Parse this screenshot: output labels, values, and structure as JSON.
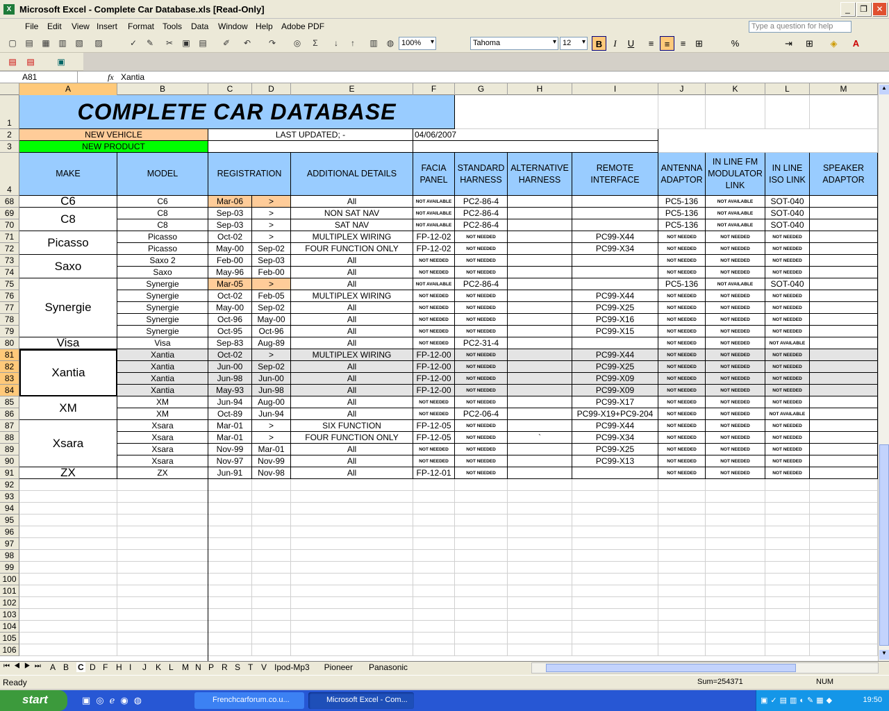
{
  "window": {
    "title": "Microsoft Excel - Complete Car Database.xls  [Read-Only]"
  },
  "menu": [
    "File",
    "Edit",
    "View",
    "Insert",
    "Format",
    "Tools",
    "Data",
    "Window",
    "Help",
    "Adobe PDF"
  ],
  "help_placeholder": "Type a question for help",
  "toolbar": {
    "zoom": "100%",
    "font": "Tahoma",
    "size": "12"
  },
  "formula": {
    "namebox": "A81",
    "fx": "fx",
    "value": "Xantia"
  },
  "columns": [
    "A",
    "B",
    "C",
    "D",
    "E",
    "F",
    "G",
    "H",
    "I",
    "J",
    "K",
    "L",
    "M"
  ],
  "title": "COMPLETE CAR DATABASE",
  "row2": {
    "new_vehicle": "NEW VEHICLE",
    "last_updated": "LAST UPDATED;  -",
    "date": "04/06/2007"
  },
  "row3": {
    "new_product": "NEW PRODUCT"
  },
  "headers": [
    "MAKE",
    "MODEL",
    "REGISTRATION",
    "ADDITIONAL DETAILS",
    "FACIA PANEL",
    "STANDARD HARNESS",
    "ALTERNATIVE HARNESS",
    "REMOTE INTERFACE",
    "ANTENNA ADAPTOR",
    "IN LINE FM MODULATOR LINK",
    "IN LINE ISO LINK",
    "SPEAKER ADAPTOR"
  ],
  "makes": [
    {
      "name": "C6",
      "rows": [
        68
      ]
    },
    {
      "name": "C8",
      "rows": [
        69,
        70
      ]
    },
    {
      "name": "Picasso",
      "rows": [
        71,
        72
      ]
    },
    {
      "name": "Saxo",
      "rows": [
        73,
        74
      ]
    },
    {
      "name": "Synergie",
      "rows": [
        75,
        76,
        77,
        78,
        79
      ]
    },
    {
      "name": "Visa",
      "rows": [
        80
      ]
    },
    {
      "name": "Xantia",
      "rows": [
        81,
        82,
        83,
        84
      ]
    },
    {
      "name": "XM",
      "rows": [
        85,
        86
      ]
    },
    {
      "name": "Xsara",
      "rows": [
        87,
        88,
        89,
        90
      ]
    },
    {
      "name": "ZX",
      "rows": [
        91
      ]
    }
  ],
  "rows": [
    {
      "n": "68",
      "model": "C6",
      "from": "Mar-06",
      "to": ">",
      "details": "All",
      "facia": "NOT AVAILABLE",
      "std": "PC2-86-4",
      "alt": "",
      "remote": "",
      "ant": "PC5-136",
      "fm": "NOT AVAILABLE",
      "iso": "SOT-040",
      "new": true
    },
    {
      "n": "69",
      "model": "C8",
      "from": "Sep-03",
      "to": ">",
      "details": "NON SAT NAV",
      "facia": "NOT AVAILABLE",
      "std": "PC2-86-4",
      "alt": "",
      "remote": "",
      "ant": "PC5-136",
      "fm": "NOT AVAILABLE",
      "iso": "SOT-040"
    },
    {
      "n": "70",
      "model": "C8",
      "from": "Sep-03",
      "to": ">",
      "details": "SAT NAV",
      "facia": "NOT AVAILABLE",
      "std": "PC2-86-4",
      "alt": "",
      "remote": "",
      "ant": "PC5-136",
      "fm": "NOT AVAILABLE",
      "iso": "SOT-040"
    },
    {
      "n": "71",
      "model": "Picasso",
      "from": "Oct-02",
      "to": ">",
      "details": "MULTIPLEX WIRING",
      "facia": "FP-12-02",
      "std": "NOT NEEDED",
      "alt": "",
      "remote": "PC99-X44",
      "ant": "NOT NEEDED",
      "fm": "NOT NEEDED",
      "iso": "NOT NEEDED"
    },
    {
      "n": "72",
      "model": "Picasso",
      "from": "May-00",
      "to": "Sep-02",
      "details": "FOUR FUNCTION ONLY",
      "facia": "FP-12-02",
      "std": "NOT NEEDED",
      "alt": "",
      "remote": "PC99-X34",
      "ant": "NOT NEEDED",
      "fm": "NOT NEEDED",
      "iso": "NOT NEEDED"
    },
    {
      "n": "73",
      "model": "Saxo 2",
      "from": "Feb-00",
      "to": "Sep-03",
      "details": "All",
      "facia": "NOT NEEDED",
      "std": "NOT NEEDED",
      "alt": "",
      "remote": "",
      "ant": "NOT NEEDED",
      "fm": "NOT NEEDED",
      "iso": "NOT NEEDED"
    },
    {
      "n": "74",
      "model": "Saxo",
      "from": "May-96",
      "to": "Feb-00",
      "details": "All",
      "facia": "NOT NEEDED",
      "std": "NOT NEEDED",
      "alt": "",
      "remote": "",
      "ant": "NOT NEEDED",
      "fm": "NOT NEEDED",
      "iso": "NOT NEEDED"
    },
    {
      "n": "75",
      "model": "Synergie",
      "from": "Mar-05",
      "to": ">",
      "details": "All",
      "facia": "NOT AVAILABLE",
      "std": "PC2-86-4",
      "alt": "",
      "remote": "",
      "ant": "PC5-136",
      "fm": "NOT AVAILABLE",
      "iso": "SOT-040",
      "new": true
    },
    {
      "n": "76",
      "model": "Synergie",
      "from": "Oct-02",
      "to": "Feb-05",
      "details": "MULTIPLEX WIRING",
      "facia": "NOT NEEDED",
      "std": "NOT NEEDED",
      "alt": "",
      "remote": "PC99-X44",
      "ant": "NOT NEEDED",
      "fm": "NOT NEEDED",
      "iso": "NOT NEEDED"
    },
    {
      "n": "77",
      "model": "Synergie",
      "from": "May-00",
      "to": "Sep-02",
      "details": "All",
      "facia": "NOT NEEDED",
      "std": "NOT NEEDED",
      "alt": "",
      "remote": "PC99-X25",
      "ant": "NOT NEEDED",
      "fm": "NOT NEEDED",
      "iso": "NOT NEEDED"
    },
    {
      "n": "78",
      "model": "Synergie",
      "from": "Oct-96",
      "to": "May-00",
      "details": "All",
      "facia": "NOT NEEDED",
      "std": "NOT NEEDED",
      "alt": "",
      "remote": "PC99-X16",
      "ant": "NOT NEEDED",
      "fm": "NOT NEEDED",
      "iso": "NOT NEEDED"
    },
    {
      "n": "79",
      "model": "Synergie",
      "from": "Oct-95",
      "to": "Oct-96",
      "details": "All",
      "facia": "NOT NEEDED",
      "std": "NOT NEEDED",
      "alt": "",
      "remote": "PC99-X15",
      "ant": "NOT NEEDED",
      "fm": "NOT NEEDED",
      "iso": "NOT NEEDED"
    },
    {
      "n": "80",
      "model": "Visa",
      "from": "Sep-83",
      "to": "Aug-89",
      "details": "All",
      "facia": "NOT NEEDED",
      "std": "PC2-31-4",
      "alt": "",
      "remote": "",
      "ant": "NOT NEEDED",
      "fm": "NOT NEEDED",
      "iso": "NOT AVAILABLE"
    },
    {
      "n": "81",
      "model": "Xantia",
      "from": "Oct-02",
      "to": ">",
      "details": "MULTIPLEX WIRING",
      "facia": "FP-12-00",
      "std": "NOT NEEDED",
      "alt": "",
      "remote": "PC99-X44",
      "ant": "NOT NEEDED",
      "fm": "NOT NEEDED",
      "iso": "NOT NEEDED",
      "sel": true
    },
    {
      "n": "82",
      "model": "Xantia",
      "from": "Jun-00",
      "to": "Sep-02",
      "details": "All",
      "facia": "FP-12-00",
      "std": "NOT NEEDED",
      "alt": "",
      "remote": "PC99-X25",
      "ant": "NOT NEEDED",
      "fm": "NOT NEEDED",
      "iso": "NOT NEEDED",
      "sel": true
    },
    {
      "n": "83",
      "model": "Xantia",
      "from": "Jun-98",
      "to": "Jun-00",
      "details": "All",
      "facia": "FP-12-00",
      "std": "NOT NEEDED",
      "alt": "",
      "remote": "PC99-X09",
      "ant": "NOT NEEDED",
      "fm": "NOT NEEDED",
      "iso": "NOT NEEDED",
      "sel": true
    },
    {
      "n": "84",
      "model": "Xantia",
      "from": "May-93",
      "to": "Jun-98",
      "details": "All",
      "facia": "FP-12-00",
      "std": "NOT NEEDED",
      "alt": "",
      "remote": "PC99-X09",
      "ant": "NOT NEEDED",
      "fm": "NOT NEEDED",
      "iso": "NOT NEEDED",
      "sel": true
    },
    {
      "n": "85",
      "model": "XM",
      "from": "Jun-94",
      "to": "Aug-00",
      "details": "All",
      "facia": "NOT NEEDED",
      "std": "NOT NEEDED",
      "alt": "",
      "remote": "PC99-X17",
      "ant": "NOT NEEDED",
      "fm": "NOT NEEDED",
      "iso": "NOT NEEDED"
    },
    {
      "n": "86",
      "model": "XM",
      "from": "Oct-89",
      "to": "Jun-94",
      "details": "All",
      "facia": "NOT NEEDED",
      "std": "PC2-06-4",
      "alt": "",
      "remote": "PC99-X19+PC9-204",
      "ant": "NOT NEEDED",
      "fm": "NOT NEEDED",
      "iso": "NOT AVAILABLE"
    },
    {
      "n": "87",
      "model": "Xsara",
      "from": "Mar-01",
      "to": ">",
      "details": "SIX FUNCTION",
      "facia": "FP-12-05",
      "std": "NOT NEEDED",
      "alt": "",
      "remote": "PC99-X44",
      "ant": "NOT NEEDED",
      "fm": "NOT NEEDED",
      "iso": "NOT NEEDED"
    },
    {
      "n": "88",
      "model": "Xsara",
      "from": "Mar-01",
      "to": ">",
      "details": "FOUR FUNCTION ONLY",
      "facia": "FP-12-05",
      "std": "NOT NEEDED",
      "alt": "`",
      "remote": "PC99-X34",
      "ant": "NOT NEEDED",
      "fm": "NOT NEEDED",
      "iso": "NOT NEEDED"
    },
    {
      "n": "89",
      "model": "Xsara",
      "from": "Nov-99",
      "to": "Mar-01",
      "details": "All",
      "facia": "NOT NEEDED",
      "std": "NOT NEEDED",
      "alt": "",
      "remote": "PC99-X25",
      "ant": "NOT NEEDED",
      "fm": "NOT NEEDED",
      "iso": "NOT NEEDED"
    },
    {
      "n": "90",
      "model": "Xsara",
      "from": "Nov-97",
      "to": "Nov-99",
      "details": "All",
      "facia": "NOT NEEDED",
      "std": "NOT NEEDED",
      "alt": "",
      "remote": "PC99-X13",
      "ant": "NOT NEEDED",
      "fm": "NOT NEEDED",
      "iso": "NOT NEEDED"
    },
    {
      "n": "91",
      "model": "ZX",
      "from": "Jun-91",
      "to": "Nov-98",
      "details": "All",
      "facia": "FP-12-01",
      "std": "NOT NEEDED",
      "alt": "",
      "remote": "",
      "ant": "NOT NEEDED",
      "fm": "NOT NEEDED",
      "iso": "NOT NEEDED"
    }
  ],
  "empty_rows": [
    "92",
    "93",
    "94",
    "95",
    "96",
    "97",
    "98",
    "99",
    "100",
    "101",
    "102",
    "103",
    "104",
    "105",
    "106"
  ],
  "sheet_tabs": [
    "A",
    "B",
    "C",
    "D",
    "F",
    "H",
    "I",
    "J",
    "K",
    "L",
    "M",
    "N",
    "P",
    "R",
    "S",
    "T",
    "V",
    "Ipod-Mp3",
    "Pioneer",
    "Panasonic"
  ],
  "active_tab": "C",
  "status": {
    "ready": "Ready",
    "sum": "Sum=254371",
    "num": "NUM"
  },
  "taskbar": {
    "start": "start",
    "tasks": [
      "Frenchcarforum.co.u...",
      "Microsoft Excel - Com..."
    ],
    "clock": "19:50"
  },
  "colors": {
    "header_blue": "#99ccff",
    "new_vehicle": "#ffcc99",
    "new_product": "#00ff00",
    "selection": "#ffc97a"
  }
}
